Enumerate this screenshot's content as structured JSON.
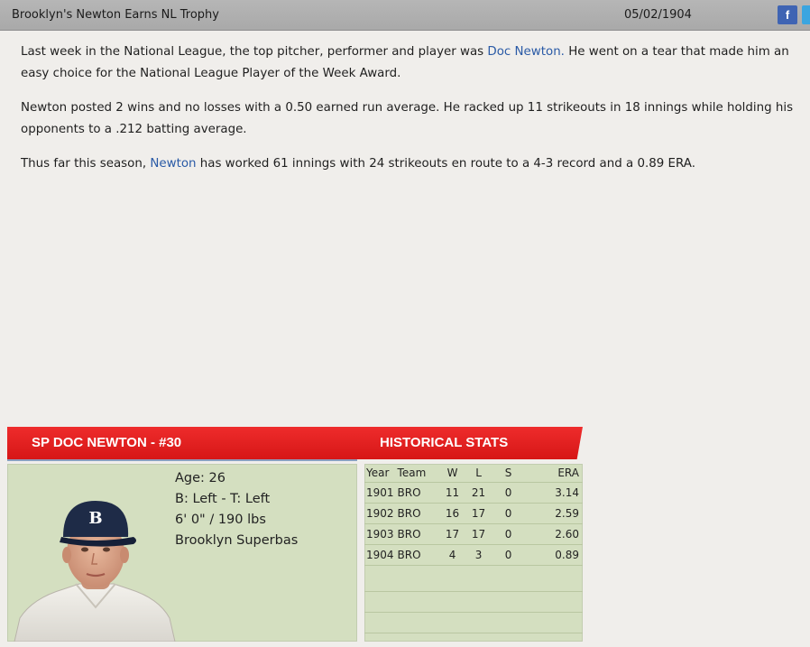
{
  "header": {
    "headline": "Brooklyn's Newton Earns NL Trophy",
    "date": "05/02/1904",
    "facebook_label": "f"
  },
  "article": {
    "p1_before": "Last week in the National League, the top pitcher, performer and player was ",
    "p1_link": "Doc Newton.",
    "p1_after": " He went on a tear that made him an easy choice for the National League Player of the Week Award.",
    "p2": "Newton posted 2 wins and no losses with a 0.50 earned run average. He racked up 11 strikeouts in 18 innings while holding his opponents to a .212 batting average.",
    "p3_before": "Thus far this season, ",
    "p3_link": "Newton",
    "p3_after": " has worked 61 innings with 24 strikeouts en route to a 4-3 record and a 0.89 ERA."
  },
  "player": {
    "banner": "SP DOC NEWTON - #30",
    "age": "Age: 26",
    "bats_throws": "B: Left - T: Left",
    "height_weight": "6' 0\" / 190 lbs",
    "team": "Brooklyn Superbas",
    "cap_letter": "B"
  },
  "stats": {
    "banner": "HISTORICAL STATS",
    "headers": [
      "Year",
      "Team",
      "W",
      "L",
      "S",
      "ERA"
    ],
    "rows": [
      [
        "1901",
        "BRO",
        "11",
        "21",
        "0",
        "3.14"
      ],
      [
        "1902",
        "BRO",
        "16",
        "17",
        "0",
        "2.59"
      ],
      [
        "1903",
        "BRO",
        "17",
        "17",
        "0",
        "2.60"
      ],
      [
        "1904",
        "BRO",
        "4",
        "3",
        "0",
        "0.89"
      ]
    ]
  }
}
